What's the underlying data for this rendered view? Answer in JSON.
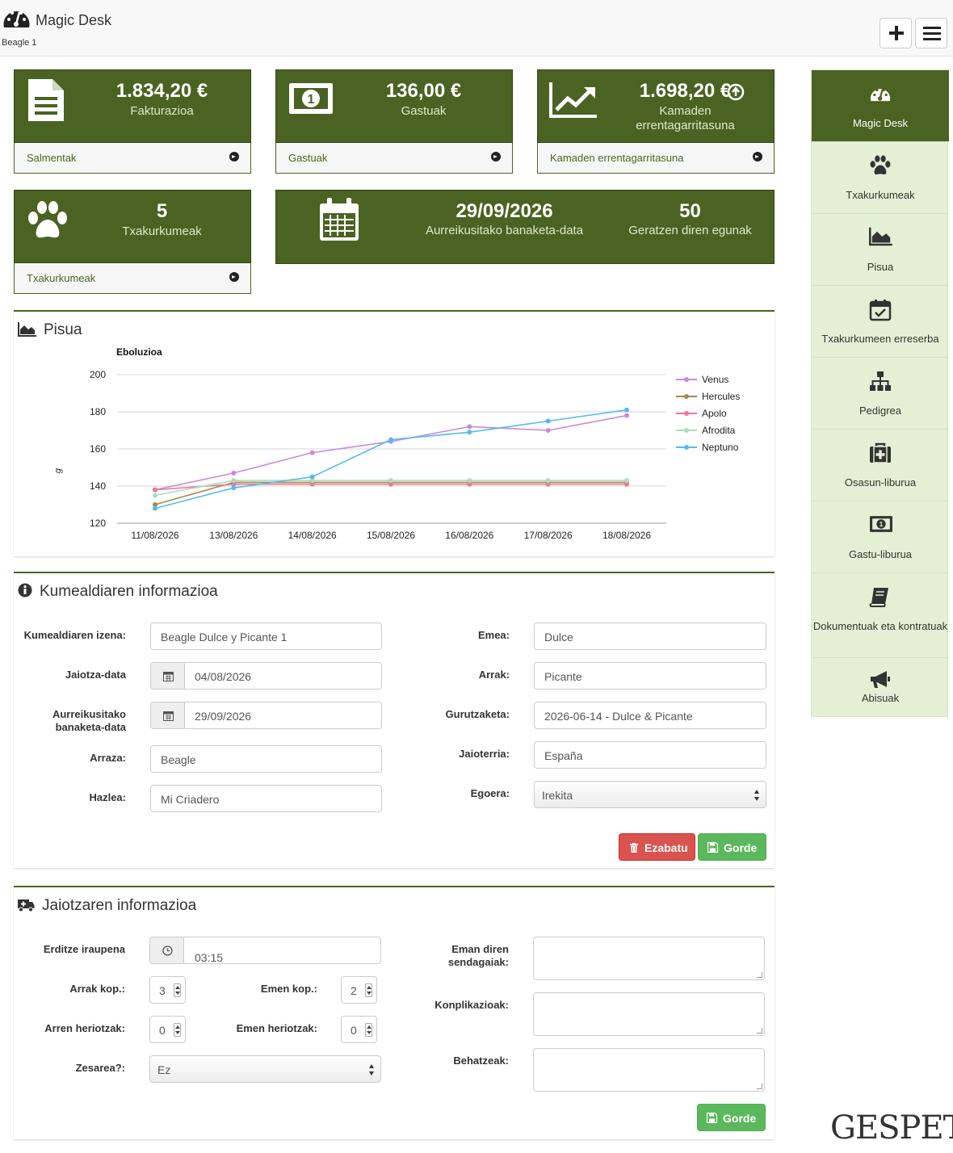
{
  "header": {
    "title": "Magic Desk",
    "subtitle": "Beagle 1"
  },
  "tiles": [
    {
      "value": "1.834,20 €",
      "label": "Fakturazioa",
      "link": "Salmentak"
    },
    {
      "value": "136,00 €",
      "label": "Gastuak",
      "link": "Gastuak"
    },
    {
      "value": "1.698,20 €",
      "label": "Kamaden errentagarritasuna",
      "link": "Kamaden errentagarritasuna"
    },
    {
      "value": "5",
      "label": "Txakurkumeak",
      "link": "Txakurkumeak"
    }
  ],
  "sale_tile": {
    "date": "29/09/2026",
    "date_label": "Aurreikusitako banaketa-data",
    "days": "50",
    "days_label": "Geratzen diren egunak"
  },
  "weight_panel": {
    "title": "Pisua"
  },
  "chart_data": {
    "type": "line",
    "title": "Eboluzioa",
    "xlabel": "",
    "ylabel": "g",
    "ylim": [
      120,
      200
    ],
    "yticks": [
      120,
      140,
      160,
      180,
      200
    ],
    "grid": true,
    "legend_position": "right",
    "x": [
      "11/08/2026",
      "13/08/2026",
      "14/08/2026",
      "15/08/2026",
      "16/08/2026",
      "17/08/2026",
      "18/08/2026"
    ],
    "series": [
      {
        "name": "Venus",
        "color": "#cc88dd",
        "values": [
          138,
          147,
          158,
          164,
          172,
          170,
          178
        ]
      },
      {
        "name": "Hercules",
        "color": "#aa8844",
        "values": [
          130,
          142,
          142,
          142,
          142,
          142,
          142
        ]
      },
      {
        "name": "Apolo",
        "color": "#ee7799",
        "values": [
          138,
          141,
          141,
          141,
          141,
          141,
          141
        ]
      },
      {
        "name": "Afrodita",
        "color": "#aaddbb",
        "values": [
          135,
          143,
          143,
          143,
          143,
          143,
          143
        ]
      },
      {
        "name": "Neptuno",
        "color": "#55bbee",
        "values": [
          128,
          139,
          145,
          165,
          169,
          175,
          181
        ]
      }
    ]
  },
  "litter": {
    "title": "Kumealdiaren informazioa",
    "name_label": "Kumealdiaren izena:",
    "name_value": "Beagle Dulce y Picante 1",
    "birth_label": "Jaiotza-data",
    "birth_value": "04/08/2026",
    "sale_label": "Aurreikusitako banaketa-data",
    "sale_value": "29/09/2026",
    "breed_label": "Arraza:",
    "breed_value": "Beagle",
    "breeder_label": "Hazlea:",
    "breeder_value": "Mi Criadero",
    "female_label": "Emea:",
    "female_value": "Dulce",
    "male_label": "Arrak:",
    "male_value": "Picante",
    "cross_label": "Gurutzaketa:",
    "cross_value": "2026-06-14 - Dulce & Picante",
    "country_label": "Jaioterria:",
    "country_value": "España",
    "status_label": "Egoera:",
    "status_value": "Irekita",
    "delete_label": "Ezabatu",
    "save_label": "Gorde"
  },
  "birth": {
    "title": "Jaiotzaren informazioa",
    "duration_label": "Erditze iraupena",
    "duration_value": "03:15",
    "males_label": "Arrak kop.:",
    "males_value": "3",
    "females_label": "Emen kop.:",
    "females_value": "2",
    "male_deaths_label": "Arren heriotzak:",
    "male_deaths_value": "0",
    "female_deaths_label": "Emen heriotzak:",
    "female_deaths_value": "0",
    "cesarean_label": "Zesarea?:",
    "cesarean_value": "Ez",
    "meds_label": "Eman diren sendagaiak:",
    "complications_label": "Konplikazioak:",
    "notes_label": "Behatzeak:",
    "save_label": "Gorde"
  },
  "sidebar": {
    "items": [
      {
        "label": "Magic Desk"
      },
      {
        "label": "Txakurkumeak"
      },
      {
        "label": "Pisua"
      },
      {
        "label": "Txakurkumeen erreserba"
      },
      {
        "label": "Pedigrea"
      },
      {
        "label": "Osasun-liburua"
      },
      {
        "label": "Gastu-liburua"
      },
      {
        "label": "Dokumentuak eta kontratuak"
      },
      {
        "label": "Abisuak"
      }
    ]
  },
  "brand": "GESPET"
}
